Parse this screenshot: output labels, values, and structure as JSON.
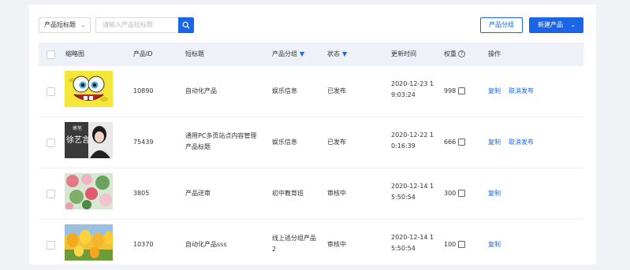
{
  "toolbar": {
    "select_label": "产品短标题",
    "search_placeholder": "请输入产品短标题",
    "category_button": "产品分组",
    "new_button": "新建产品"
  },
  "table": {
    "headers": {
      "thumbnail": "缩略图",
      "id": "产品ID",
      "title": "短标题",
      "group": "产品分组",
      "status": "状态",
      "updated": "更新时间",
      "weight": "权重",
      "actions": "操作"
    },
    "rows": [
      {
        "id": "10890",
        "title_l1": "自动化产品",
        "title_l2": "",
        "group_l1": "娱乐信息",
        "group_l2": "",
        "status": "已发布",
        "time_l1": "2020-12-23 1",
        "time_l2": "9:03:24",
        "weight": "998",
        "action1": "复制",
        "action2": "取消发布"
      },
      {
        "id": "75439",
        "title_l1": "通用PC多页站点内容管理",
        "title_l2": "产品标题",
        "group_l1": "娱乐信息",
        "group_l2": "",
        "status": "已发布",
        "time_l1": "2020-12-22 1",
        "time_l2": "0:16:39",
        "weight": "666",
        "action1": "复制",
        "action2": "取消发布"
      },
      {
        "id": "3805",
        "title_l1": "产品送审",
        "title_l2": "",
        "group_l1": "初中教育班",
        "group_l2": "",
        "status": "审核中",
        "time_l1": "2020-12-14 1",
        "time_l2": "5:50:54",
        "weight": "300",
        "action1": "复制",
        "action2": ""
      },
      {
        "id": "10370",
        "title_l1": "自动化产品sss",
        "title_l2": "",
        "group_l1": "线上逃分组产品",
        "group_l2": "2",
        "status": "审核中",
        "time_l1": "2020-12-14 1",
        "time_l2": "5:50:54",
        "weight": "100",
        "action1": "复制",
        "action2": ""
      }
    ],
    "thumb2_text_top": "寒笔",
    "thumb2_text_main": "徐艺言"
  },
  "colors": {
    "primary": "#1a66e6",
    "header_bg": "#eef1f7"
  }
}
